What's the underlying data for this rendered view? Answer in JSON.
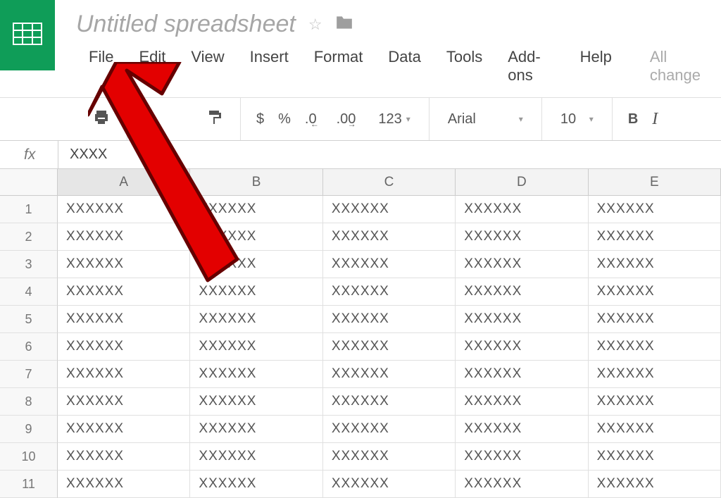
{
  "header": {
    "title": "Untitled spreadsheet",
    "save_status": "All change"
  },
  "menu": {
    "file": "File",
    "edit": "Edit",
    "view": "View",
    "insert": "Insert",
    "format": "Format",
    "data": "Data",
    "tools": "Tools",
    "addons": "Add-ons",
    "help": "Help"
  },
  "toolbar": {
    "currency": "$",
    "percent": "%",
    "dec_minus": ".0",
    "dec_plus": ".00",
    "more_formats": "123",
    "font_name": "Arial",
    "font_size": "10",
    "bold": "B",
    "italic": "I"
  },
  "formula_bar": {
    "fx": "fx",
    "value": "XXXX"
  },
  "columns": [
    "A",
    "B",
    "C",
    "D",
    "E"
  ],
  "rows": [
    "1",
    "2",
    "3",
    "4",
    "5",
    "6",
    "7",
    "8",
    "9",
    "10",
    "11"
  ],
  "cell_value": "XXXXXX"
}
